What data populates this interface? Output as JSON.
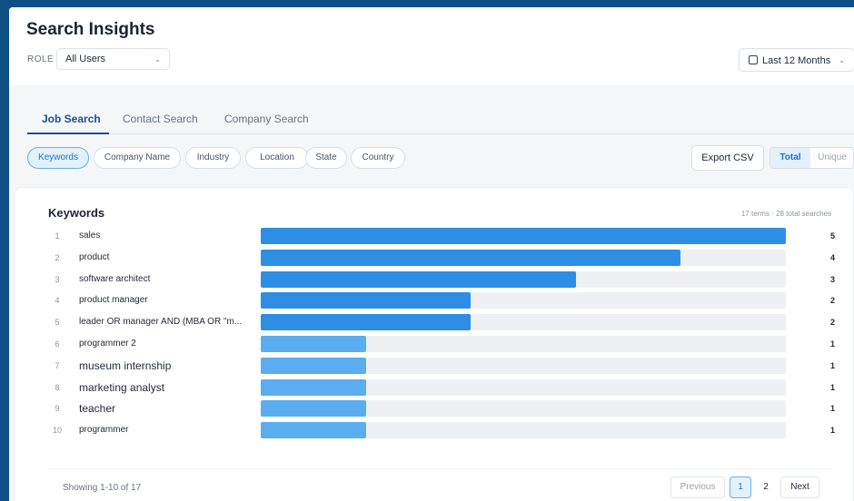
{
  "header": {
    "title": "Search Insights",
    "role_label": "ROLE",
    "role_value": "All Users",
    "date_range": "Last 12 Months"
  },
  "tabs": [
    {
      "label": "Job Search",
      "active": true
    },
    {
      "label": "Contact Search",
      "active": false
    },
    {
      "label": "Company Search",
      "active": false
    }
  ],
  "filters": [
    {
      "label": "Keywords",
      "active": true
    },
    {
      "label": "Company Name",
      "active": false
    },
    {
      "label": "Industry",
      "active": false
    },
    {
      "label": "Location",
      "active": false
    },
    {
      "label": "State",
      "active": false
    },
    {
      "label": "Country",
      "active": false
    }
  ],
  "actions": {
    "export_label": "Export CSV",
    "toggle_total": "Total",
    "toggle_unique": "Unique"
  },
  "card": {
    "title": "Keywords",
    "meta": "17 terms · 28 total searches"
  },
  "chart_data": {
    "type": "bar",
    "orientation": "horizontal",
    "categories": [
      "sales",
      "product",
      "software architect",
      "product manager",
      "leader OR manager AND (MBA OR \"m...",
      "programmer 2",
      "museum internship",
      "marketing analyst",
      "teacher",
      "programmer"
    ],
    "ranks": [
      "1",
      "2",
      "3",
      "4",
      "5",
      "6",
      "7",
      "8",
      "9",
      "10"
    ],
    "values": [
      5,
      4,
      3,
      2,
      2,
      1,
      1,
      1,
      1,
      1
    ],
    "xlim": [
      0,
      5
    ],
    "colors": {
      "high": "#2e8ee4",
      "low": "#5aadef"
    }
  },
  "pagination": {
    "showing": "Showing 1-10 of 17",
    "previous": "Previous",
    "pages": [
      "1",
      "2"
    ],
    "current": "1",
    "next": "Next"
  }
}
